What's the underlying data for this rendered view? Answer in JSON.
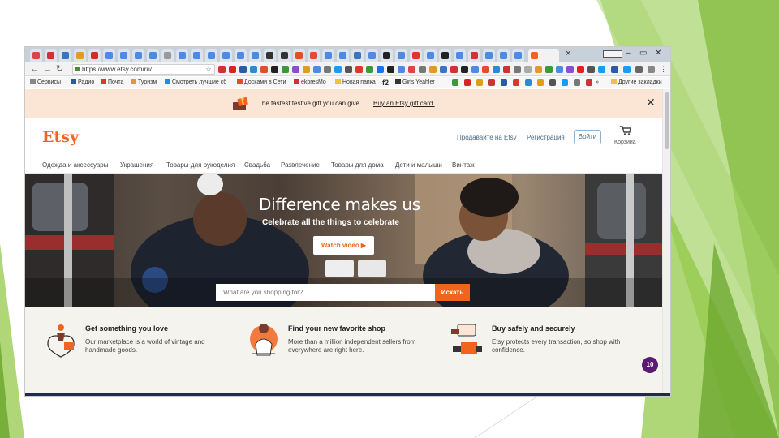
{
  "browser": {
    "url": "https://www.etsy.com/ru/",
    "tab_close": "✕",
    "window_controls": {
      "minimize": "–",
      "close": "✕"
    },
    "bookmarks": [
      {
        "label": "Сервисы"
      },
      {
        "label": "Радио"
      },
      {
        "label": "Почта"
      },
      {
        "label": "Туризм"
      },
      {
        "label": "Смотреть лучшие сб"
      },
      {
        "label": "Досками в Сети"
      },
      {
        "label": "ekpresMo"
      },
      {
        "label": "Новая папка"
      },
      {
        "label": "Girls Yeahler"
      }
    ],
    "bookmarks_more": "»",
    "bookmarks_other": "Другие закладки"
  },
  "promo": {
    "text": "The fastest festive gift you can give.",
    "link": "Buy an Etsy gift card.",
    "close": "✕"
  },
  "header": {
    "logo": "Etsy",
    "sell": "Продавайте на Etsy",
    "register": "Регистрация",
    "signin": "Войти",
    "cart": "Корзина"
  },
  "categories": [
    "Одежда и аксессуары",
    "Украшения",
    "Товары для рукоделия",
    "Свадьба",
    "Развлечение",
    "Товары для дома",
    "Дети и малыши",
    "Винтаж"
  ],
  "hero": {
    "title": "Difference makes us",
    "subtitle": "Celebrate all the things to celebrate",
    "watch_video": "Watch video ▶",
    "search_placeholder": "What are you shopping for?",
    "search_button": "Искать"
  },
  "features": [
    {
      "title": "Get something you love",
      "text": "Our marketplace is a world of vintage and handmade goods."
    },
    {
      "title": "Find your new favorite shop",
      "text": "More than a million independent sellers from everywhere are right here."
    },
    {
      "title": "Buy safely and securely",
      "text": "Etsy protects every transaction, so shop with confidence."
    }
  ],
  "chat_badge": "10",
  "colors": {
    "etsy_orange": "#f1641e",
    "promo_bg": "#fbe6d6",
    "link_blue": "#4a6b85",
    "slide_green": "#8dc63f",
    "chat_purple": "#5c1a73"
  }
}
